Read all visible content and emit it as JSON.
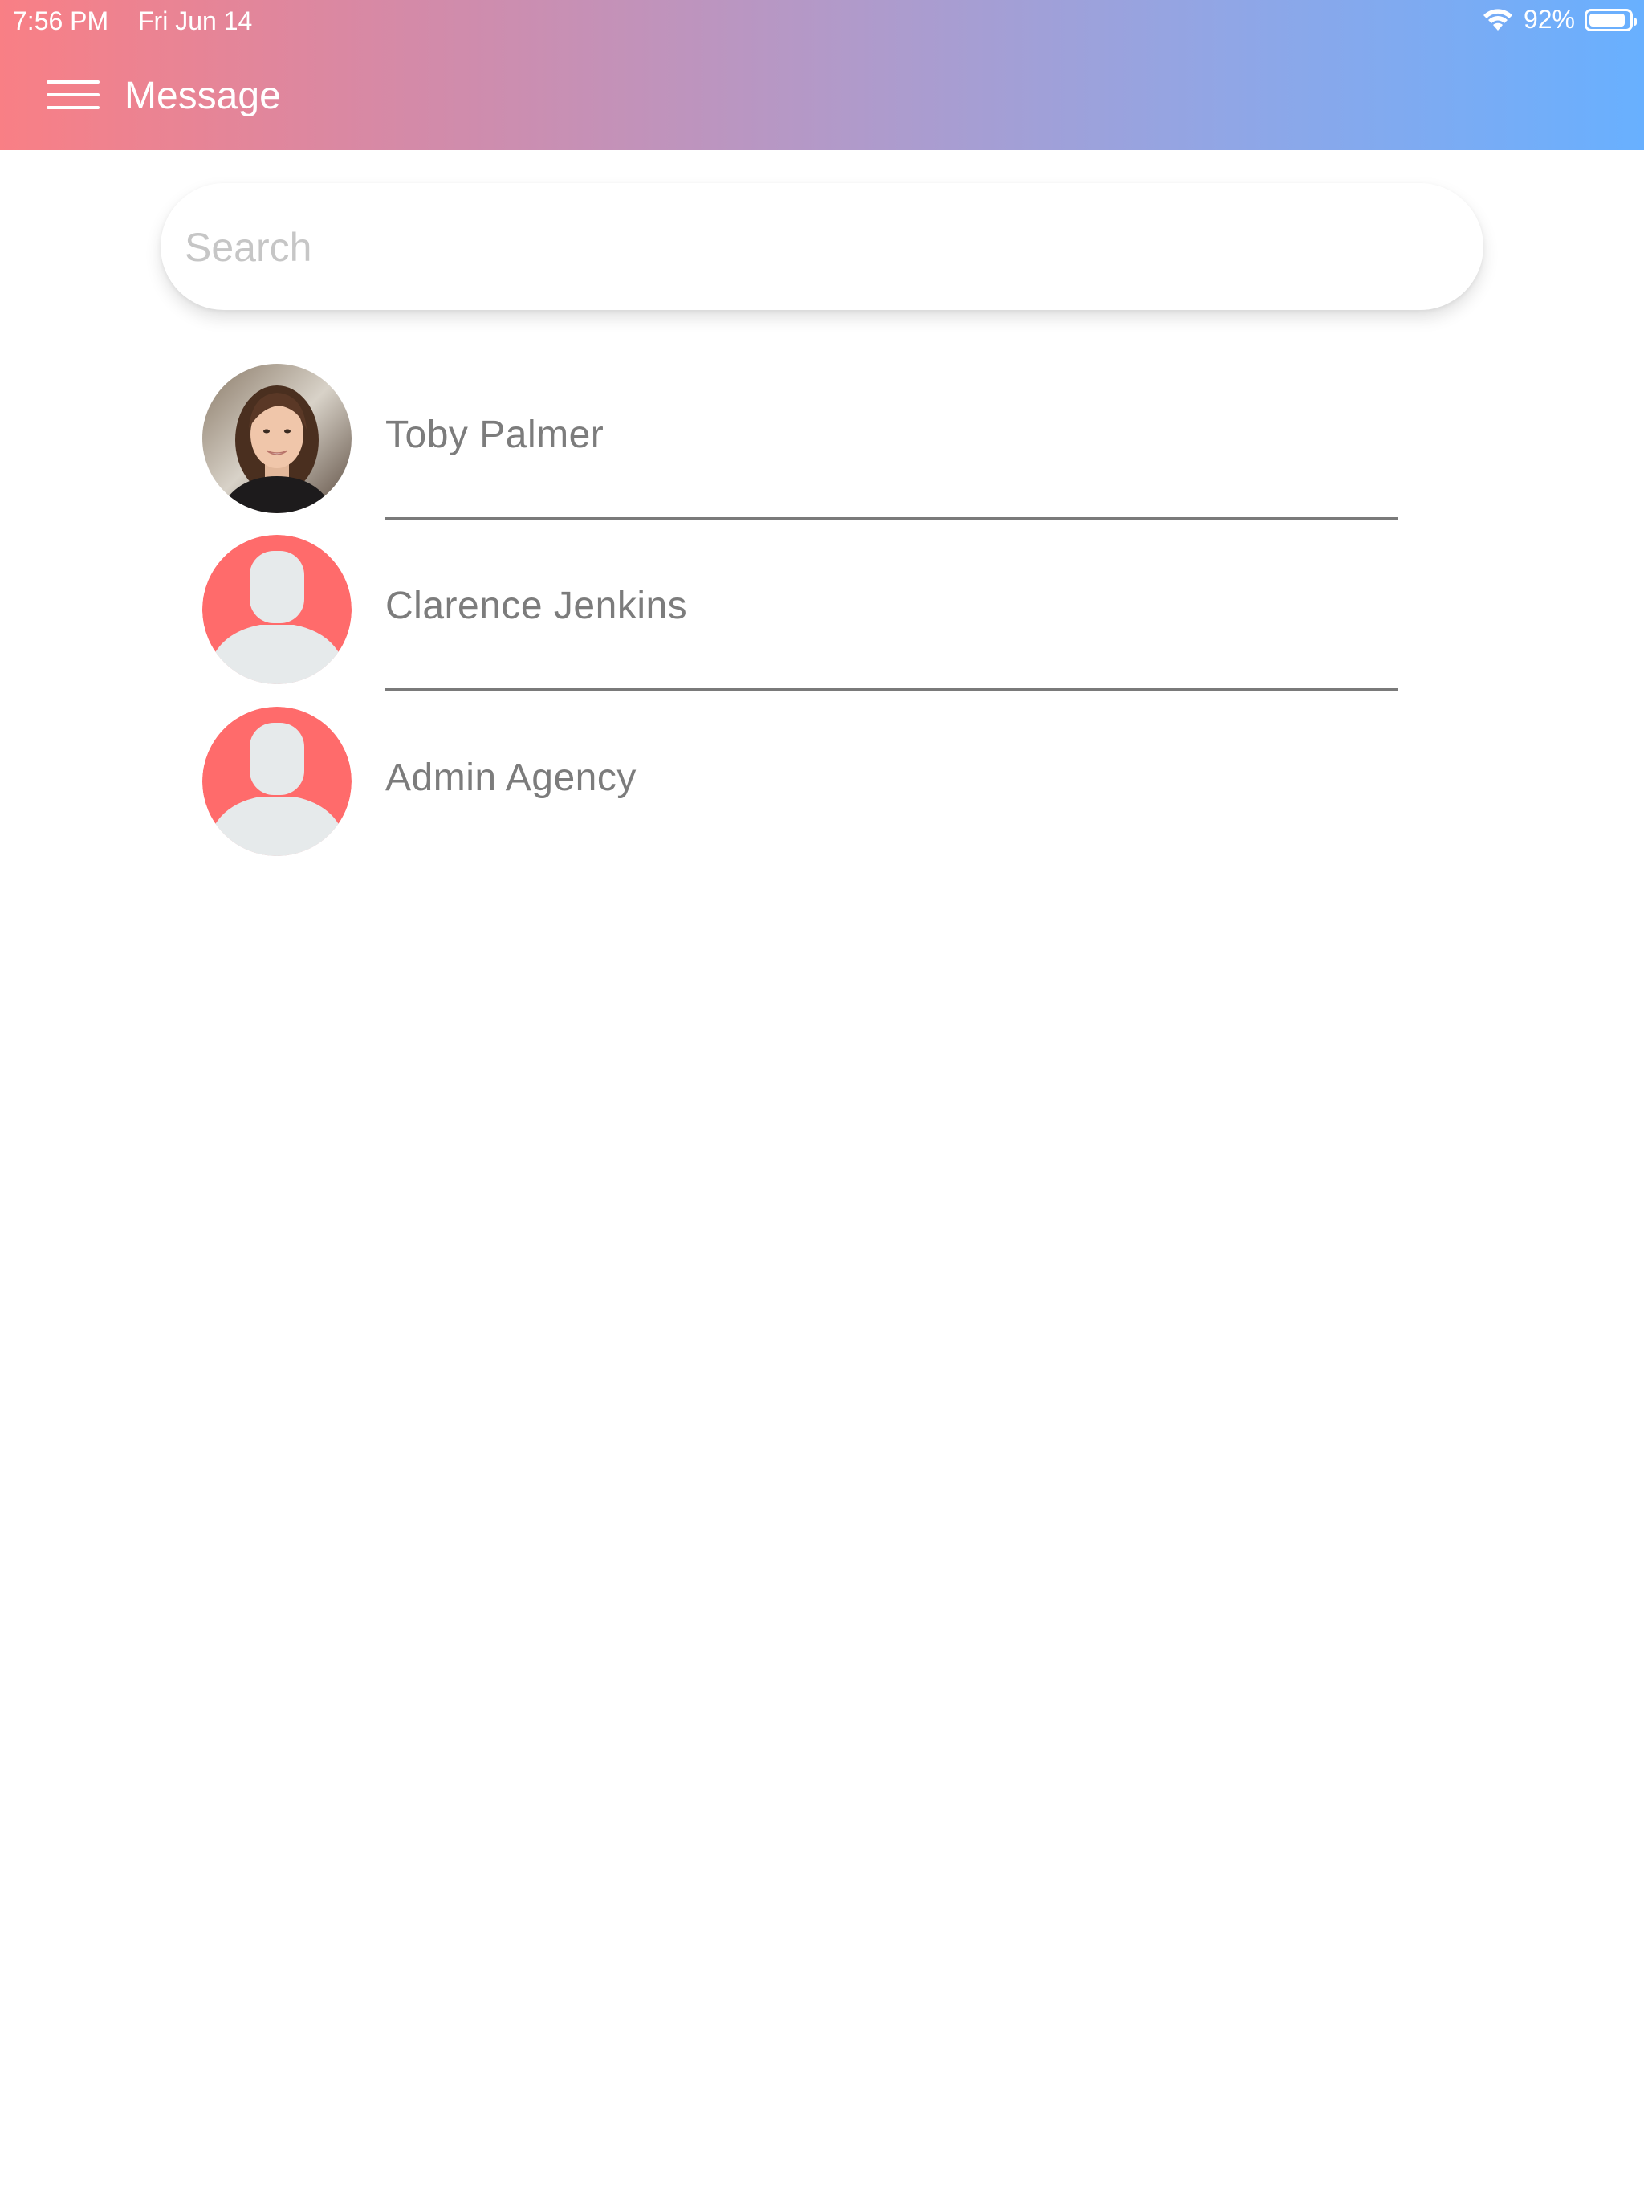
{
  "status_bar": {
    "time": "7:56 PM",
    "date": "Fri Jun 14",
    "battery": "92%",
    "battery_level": 0.92
  },
  "header": {
    "title": "Message",
    "menu_icon": "hamburger-menu-icon",
    "gradient": [
      "#f97f85",
      "#68b0ff"
    ]
  },
  "search": {
    "placeholder": "Search",
    "value": ""
  },
  "contacts": [
    {
      "name": "Toby Palmer",
      "avatar": "photo"
    },
    {
      "name": "Clarence Jenkins",
      "avatar": "default-person-icon"
    },
    {
      "name": "Admin Agency",
      "avatar": "default-person-icon"
    }
  ],
  "colors": {
    "avatar_background": "#ff6b6b",
    "silhouette": "#e6eaeb",
    "name_text": "#7c7c7c"
  }
}
